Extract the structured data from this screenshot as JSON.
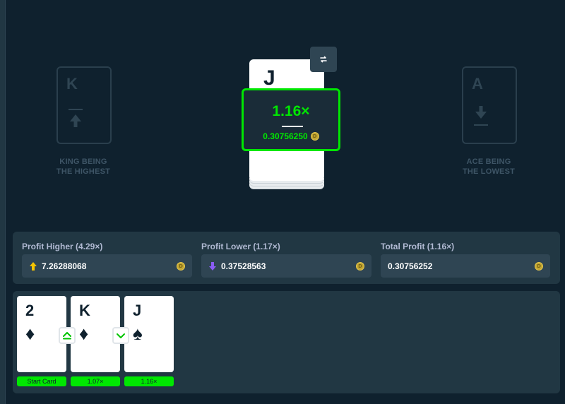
{
  "colors": {
    "background": "#0f212e",
    "panel": "#213743",
    "field": "#2f4553",
    "win": "#00e701",
    "higher_arrow": "#f5c400",
    "lower_arrow": "#8b5cf6"
  },
  "hints": {
    "high": {
      "rank": "K",
      "label_line1": "KING BEING",
      "label_line2": "THE HIGHEST",
      "icon": "arrow-up-icon"
    },
    "low": {
      "rank": "A",
      "label_line1": "ACE BEING",
      "label_line2": "THE LOWEST",
      "icon": "arrow-down-icon"
    }
  },
  "current_card": {
    "rank": "J",
    "suit": "spade"
  },
  "skip_button": {
    "icon": "swap-icon"
  },
  "payout": {
    "multiplier": "1.16×",
    "amount": "0.30756250",
    "coin": "D"
  },
  "profit": {
    "higher": {
      "label": "Profit Higher (4.29×)",
      "value": "7.26288068",
      "icon": "arrow-up-icon"
    },
    "lower": {
      "label": "Profit Lower (1.17×)",
      "value": "0.37528563",
      "icon": "arrow-down-icon"
    },
    "total": {
      "label": "Total Profit (1.16×)",
      "value": "0.30756252"
    },
    "coin": "D"
  },
  "history": [
    {
      "rank": "2",
      "suit": "♦",
      "tag": "Start Card"
    },
    {
      "rank": "K",
      "suit": "♦",
      "tag": "1.07×",
      "guess": "higher"
    },
    {
      "rank": "J",
      "suit": "♠",
      "tag": "1.16×",
      "guess": "lower"
    }
  ]
}
